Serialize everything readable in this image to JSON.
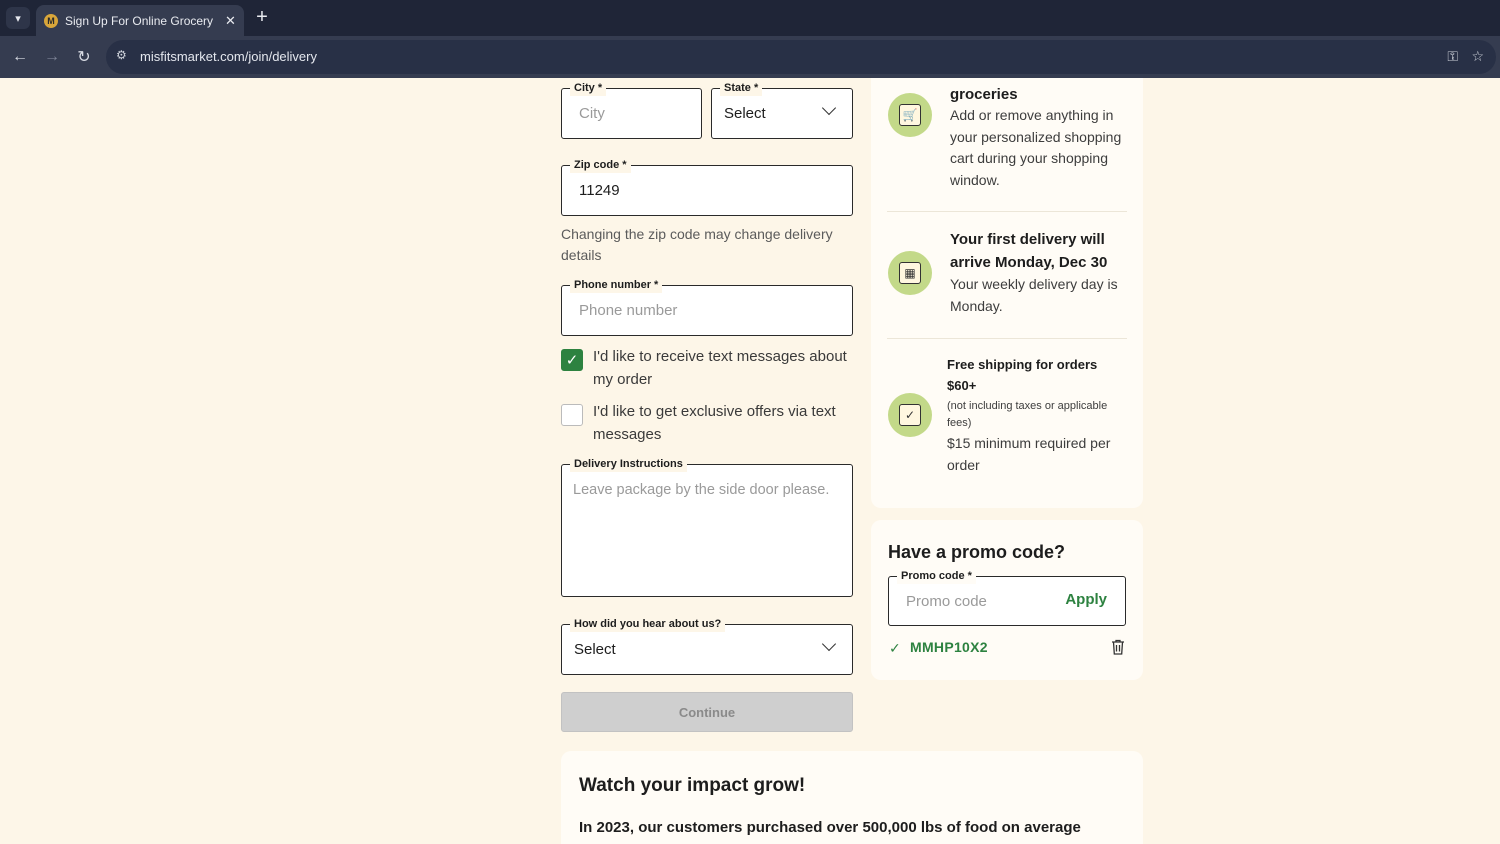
{
  "browser": {
    "tab_title": "Sign Up For Online Grocery Del",
    "favicon_letter": "M",
    "url": "misfitsmarket.com/join/delivery"
  },
  "form": {
    "city": {
      "label": "City *",
      "placeholder": "City"
    },
    "state": {
      "label": "State *",
      "value": "Select"
    },
    "zip": {
      "label": "Zip code *",
      "value": "11249"
    },
    "zip_helper": "Changing the zip code may change delivery details",
    "phone": {
      "label": "Phone number *",
      "placeholder": "Phone number"
    },
    "sms_order": {
      "label": "I'd like to receive text messages about my order",
      "checked": true
    },
    "sms_offers": {
      "label": "I'd like to get exclusive offers via text messages",
      "checked": false
    },
    "instructions": {
      "label": "Delivery Instructions",
      "placeholder": "Leave package by the side door please."
    },
    "referral": {
      "label": "How did you hear about us?",
      "value": "Select"
    },
    "continue_label": "Continue"
  },
  "benefits": [
    {
      "title": "groceries",
      "text": "Add or remove anything in your personalized shopping cart during your shopping window.",
      "icon": "cart-icon"
    },
    {
      "title": "Your first delivery will arrive Monday, Dec 30",
      "text": "Your weekly delivery day is Monday.",
      "icon": "calendar-icon"
    },
    {
      "title": "Free shipping for orders $60+",
      "note": "(not including taxes or applicable fees)",
      "text": "$15 minimum required per order",
      "icon": "checklist-icon"
    }
  ],
  "promo": {
    "title": "Have a promo code?",
    "label": "Promo code *",
    "placeholder": "Promo code",
    "apply_label": "Apply",
    "applied_code": "MMHP10X2"
  },
  "impact": {
    "title": "Watch your impact grow!",
    "text": "In 2023, our customers purchased over 500,000 lbs of food on average"
  },
  "colors": {
    "accent_green": "#2d8240",
    "page_bg": "#fdf6e8",
    "icon_circle": "#c3d989"
  }
}
